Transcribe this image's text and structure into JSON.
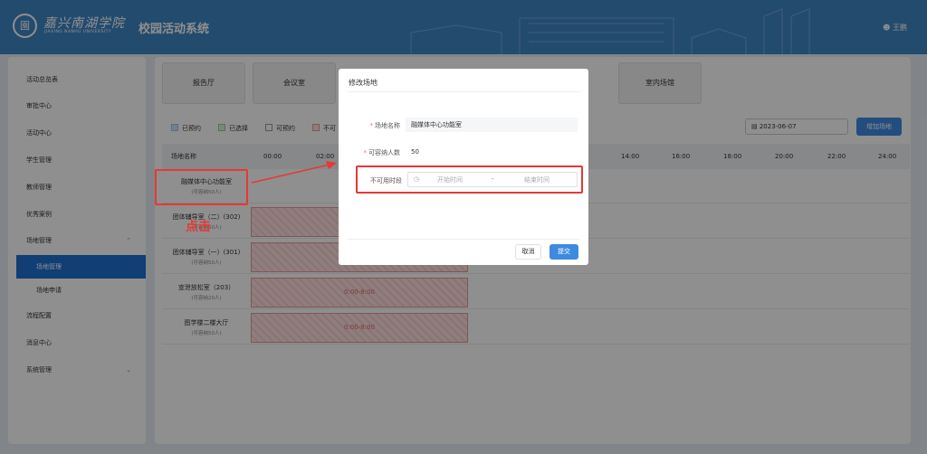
{
  "header": {
    "logo_text": "嘉兴南湖学院",
    "logo_subtitle": "JIAXING NANHU UNIVERSITY",
    "app_title": "校园活动系统",
    "user_name": "王鹏"
  },
  "sidebar": {
    "items": [
      {
        "label": "活动总览表"
      },
      {
        "label": "审批中心"
      },
      {
        "label": "活动中心"
      },
      {
        "label": "学生管理"
      },
      {
        "label": "教师管理"
      },
      {
        "label": "优秀案例"
      },
      {
        "label": "场地管理"
      },
      {
        "label": "场地管理"
      },
      {
        "label": "场地申请"
      },
      {
        "label": "流程配置"
      },
      {
        "label": "消息中心"
      },
      {
        "label": "系统管理"
      }
    ]
  },
  "venue_tabs": [
    "报告厅",
    "会议室",
    "室内场馆"
  ],
  "legend": {
    "booked": "已预约",
    "selected": "已选择",
    "available": "可预约",
    "unavailable": "不可"
  },
  "date_value": "2023-06-07",
  "add_button": "增加场地",
  "table": {
    "name_header": "场地名称",
    "times": [
      "00:00",
      "02:00",
      "14:00",
      "16:00",
      "18:00",
      "20:00",
      "22:00",
      "24:00"
    ],
    "rows": [
      {
        "name": "融媒体中心功能室",
        "capacity": "(可容纳50人)",
        "slot": ""
      },
      {
        "name": "团体辅导室（二）(302)",
        "capacity": "(可容纳50人)",
        "slot": ""
      },
      {
        "name": "团体辅导室（一）(301)",
        "capacity": "(可容纳50人)",
        "slot": ""
      },
      {
        "name": "宣泄放松室（203）",
        "capacity": "(可容纳20人)",
        "slot": "0:00-8:00"
      },
      {
        "name": "图学楼二楼大厅",
        "capacity": "(可容纳50人)",
        "slot": "0:00-8:00"
      }
    ]
  },
  "dialog": {
    "title": "修改场地",
    "name_label": "场地名称",
    "name_value": "融媒体中心功能室",
    "capacity_label": "可容纳人数",
    "capacity_value": "50",
    "unavailable_label": "不可用时段",
    "start_placeholder": "开始时间",
    "separator": "-",
    "end_placeholder": "结束时间",
    "cancel": "取消",
    "submit": "提交"
  },
  "annotation_text": "点击",
  "colors": {
    "header": "#3f86c4",
    "primary": "#1d6fd0",
    "annotation": "#e53935"
  }
}
